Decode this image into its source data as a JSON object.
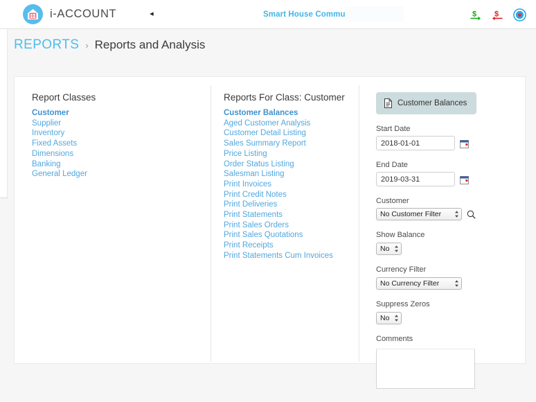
{
  "header": {
    "brand_name": "i-ACCOUNT",
    "logo_icon": "house-grid-logo-icon",
    "collapse_arrow": "◂",
    "community_title": "Smart House Community",
    "icons": [
      {
        "name": "money-in-icon",
        "title": "Receive Money"
      },
      {
        "name": "money-out-icon",
        "title": "Pay Money"
      },
      {
        "name": "favourite-icon",
        "title": "Favourites"
      }
    ]
  },
  "breadcrumb": {
    "root": "REPORTS",
    "separator": "›",
    "leaf": "Reports and Analysis"
  },
  "report_classes": {
    "heading": "Report Classes",
    "items": [
      {
        "label": "Customer",
        "active": true
      },
      {
        "label": "Supplier",
        "active": false
      },
      {
        "label": "Inventory",
        "active": false
      },
      {
        "label": "Fixed Assets",
        "active": false
      },
      {
        "label": "Dimensions",
        "active": false
      },
      {
        "label": "Banking",
        "active": false
      },
      {
        "label": "General Ledger",
        "active": false
      }
    ]
  },
  "reports_for_class": {
    "heading": "Reports For Class:  Customer",
    "items": [
      {
        "label": "Customer Balances",
        "active": true
      },
      {
        "label": "Aged Customer Analysis",
        "active": false
      },
      {
        "label": "Customer Detail Listing",
        "active": false
      },
      {
        "label": "Sales Summary Report",
        "active": false
      },
      {
        "label": "Price Listing",
        "active": false
      },
      {
        "label": "Order Status Listing",
        "active": false
      },
      {
        "label": "Salesman Listing",
        "active": false
      },
      {
        "label": "Print Invoices",
        "active": false
      },
      {
        "label": "Print Credit Notes",
        "active": false
      },
      {
        "label": "Print Deliveries",
        "active": false
      },
      {
        "label": "Print Statements",
        "active": false
      },
      {
        "label": "Print Sales Orders",
        "active": false
      },
      {
        "label": "Print Sales Quotations",
        "active": false
      },
      {
        "label": "Print Receipts",
        "active": false
      },
      {
        "label": "Print Statements Cum Invoices",
        "active": false
      }
    ]
  },
  "form": {
    "run_button_label": "Customer Balances",
    "run_button_icon": "document-icon",
    "start_date": {
      "label": "Start Date",
      "value": "2018-01-01",
      "icon": "calendar-icon"
    },
    "end_date": {
      "label": "End Date",
      "value": "2019-03-31",
      "icon": "calendar-icon"
    },
    "customer": {
      "label": "Customer",
      "value": "No Customer Filter",
      "search_icon": "search-icon"
    },
    "show_balance": {
      "label": "Show Balance",
      "value": "No"
    },
    "currency_filter": {
      "label": "Currency Filter",
      "value": "No Currency Filter"
    },
    "suppress_zeros": {
      "label": "Suppress Zeros",
      "value": "No"
    },
    "comments": {
      "label": "Comments",
      "value": "",
      "placeholder": ""
    }
  },
  "colors": {
    "brand_blue": "#57bdec",
    "link_blue": "#51a7de",
    "community_blue": "#41b6e8",
    "button_bg": "#ccdbdd",
    "money_in_green": "#18a818",
    "money_out_red": "#e02020"
  }
}
